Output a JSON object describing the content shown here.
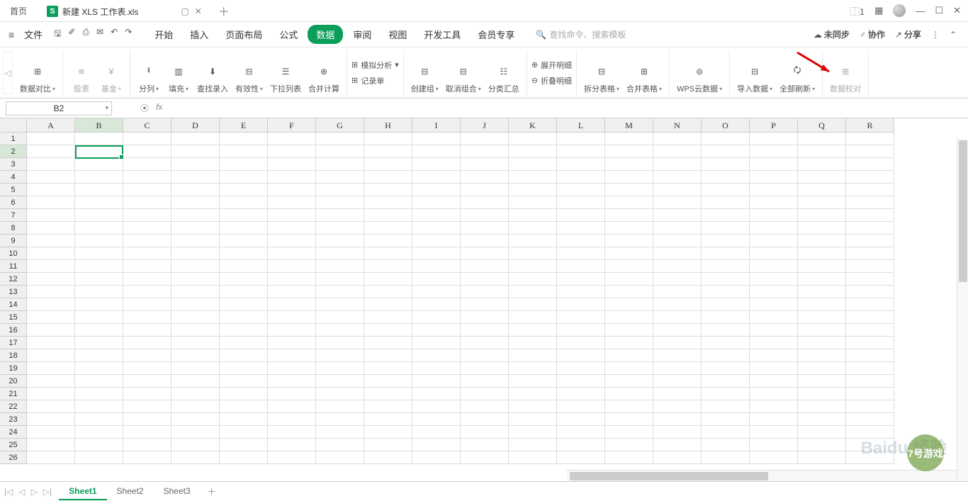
{
  "titlebar": {
    "home_tab": "首页",
    "doc_tab": "新建 XLS 工作表.xls",
    "doc_icon_letter": "S"
  },
  "menubar": {
    "file": "文件",
    "tabs": {
      "start": "开始",
      "insert": "插入",
      "layout": "页面布局",
      "formula": "公式",
      "data": "数据",
      "review": "审阅",
      "view": "视图",
      "dev": "开发工具",
      "member": "会员专享"
    },
    "search_placeholder": "查找命令、搜索模板",
    "right": {
      "unsync": "未同步",
      "collab": "协作",
      "share": "分享"
    }
  },
  "ribbon": {
    "compare": "数据对比",
    "stock": "股票",
    "fund": "基金",
    "split": "分列",
    "fill": "填充",
    "lookup": "查找录入",
    "validate": "有效性",
    "dropdown": "下拉列表",
    "consolidate": "合并计算",
    "simulate": "模拟分析",
    "recordform": "记录单",
    "group": "创建组",
    "ungroup": "取消组合",
    "subtotal": "分类汇总",
    "expand": "展开明细",
    "collapse": "折叠明细",
    "splittbl": "拆分表格",
    "mergetbl": "合并表格",
    "wpscloud": "WPS云数据",
    "import": "导入数据",
    "refresh": "全部刷新",
    "datacheck": "数据校对"
  },
  "namebox": "B2",
  "columns": [
    "A",
    "B",
    "C",
    "D",
    "E",
    "F",
    "G",
    "H",
    "I",
    "J",
    "K",
    "L",
    "M",
    "N",
    "O",
    "P",
    "Q",
    "R"
  ],
  "active_col": "B",
  "active_row": 2,
  "row_count": 26,
  "sheets": [
    "Sheet1",
    "Sheet2",
    "Sheet3"
  ],
  "active_sheet": "Sheet1",
  "watermark": "Baidu 经验"
}
